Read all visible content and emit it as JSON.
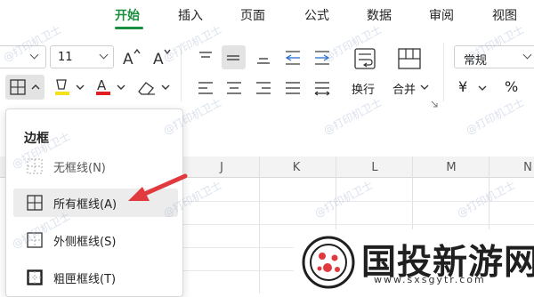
{
  "tabs": [
    "开始",
    "插入",
    "页面",
    "公式",
    "数据",
    "审阅",
    "视图"
  ],
  "active_tab": "开始",
  "font": {
    "size": "11"
  },
  "ribbon": {
    "wrap_label": "换行",
    "merge_label": "合并",
    "number_format": "常规",
    "currency_symbol": "¥",
    "percent_symbol": "%"
  },
  "columns": [
    "J",
    "K",
    "L",
    "M",
    "N"
  ],
  "border_menu": {
    "title": "边框",
    "items": [
      {
        "label": "无框线(N)"
      },
      {
        "label": "所有框线(A)"
      },
      {
        "label": "外侧框线(S)"
      },
      {
        "label": "粗匣框线(T)"
      }
    ]
  },
  "watermark": "@打印机卫士",
  "logo": {
    "text": "国投新游网",
    "url": "www.sxsgytr.com"
  },
  "colors": {
    "accent": "#1a8f3f",
    "arrow": "#e0393e",
    "font_color": "#e02020",
    "highlight": "#f5e01c"
  }
}
